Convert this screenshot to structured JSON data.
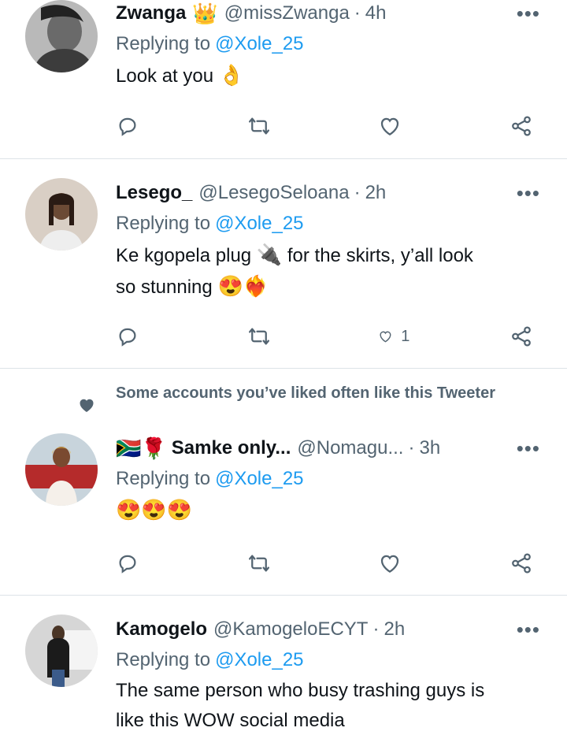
{
  "tweets": [
    {
      "name": "Zwanga",
      "name_emoji": "👑",
      "handle": "@missZwanga",
      "time": "4h",
      "reply_prefix": "Replying to",
      "reply_to": "@Xole_25",
      "text": "Look at you",
      "text_emoji": "👌",
      "like_count": ""
    },
    {
      "name": "Lesego_",
      "handle": "@LesegoSeloana",
      "time": "2h",
      "reply_prefix": "Replying to",
      "reply_to": "@Xole_25",
      "text_line1": "Ke kgopela plug",
      "plug_emoji": "🔌",
      "text_line1b": "for the skirts, y’all look",
      "text_line2": "so stunning",
      "text_emoji": "😍❤️‍🔥",
      "like_count": "1"
    },
    {
      "social_context": "Some accounts you’ve liked often like this Tweeter",
      "name_prefix_emoji": "🇿🇦🌹",
      "name": "Samke only...",
      "handle": "@Nomagu...",
      "time": "3h",
      "reply_prefix": "Replying to",
      "reply_to": "@Xole_25",
      "text_emoji": "😍😍😍",
      "like_count": ""
    },
    {
      "name": "Kamogelo",
      "handle": "@KamogeloECYT",
      "time": "2h",
      "reply_prefix": "Replying to",
      "reply_to": "@Xole_25",
      "text_line1": "The same person who busy trashing guys is",
      "text_line2": "like this WOW social media"
    }
  ],
  "dot_separator": "·",
  "more_label": "•••",
  "icons": {
    "reply": "reply-icon",
    "retweet": "retweet-icon",
    "like": "like-icon",
    "share": "share-icon",
    "more": "more-icon"
  },
  "colors": {
    "accent": "#1d9bf0",
    "secondary_text": "#536471",
    "primary_text": "#0f1419"
  }
}
